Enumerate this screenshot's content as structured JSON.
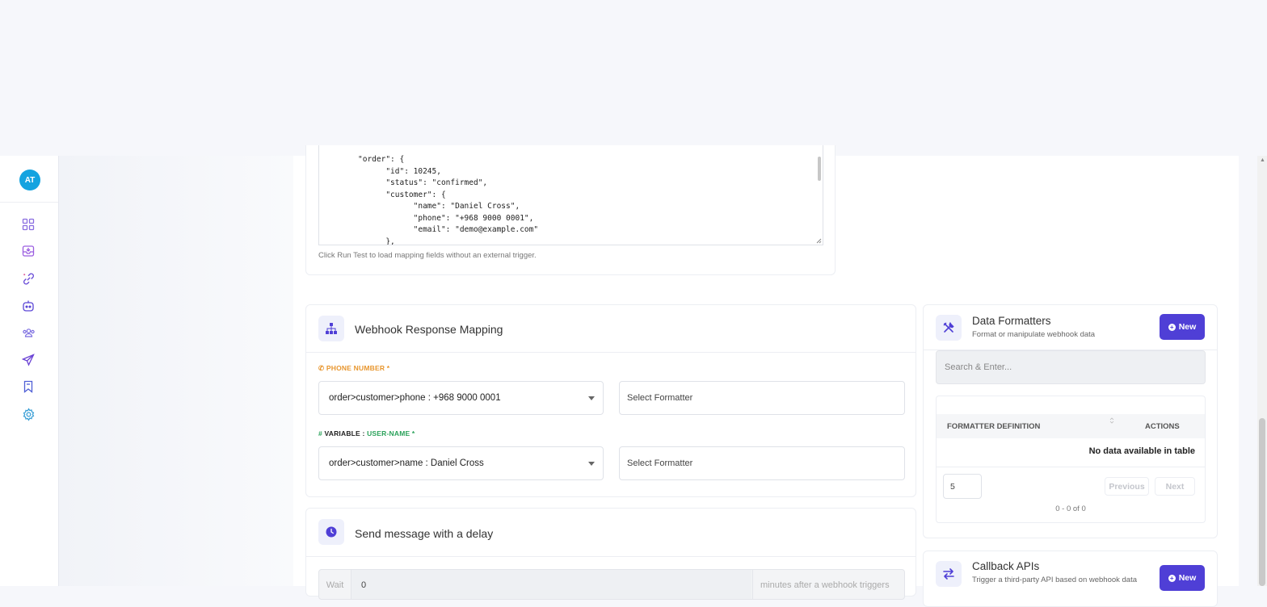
{
  "sidebar": {
    "avatar_initials": "AT",
    "items": [
      {
        "icon": "dashboard-grid-icon"
      },
      {
        "icon": "inbox-download-icon"
      },
      {
        "icon": "integration-link-icon"
      },
      {
        "icon": "bot-icon"
      },
      {
        "icon": "contacts-group-icon"
      },
      {
        "icon": "send-campaign-icon"
      },
      {
        "icon": "bookmark-icon"
      },
      {
        "icon": "settings-gear-icon"
      }
    ]
  },
  "json_test": {
    "content": "\"order\": {\n\t\"id\": 10245,\n\t\"status\": \"confirmed\",\n\t\"customer\": {\n\t\t\"name\": \"Daniel Cross\",\n\t\t\"phone\": \"+968 9000 0001\",\n\t\t\"email\": \"demo@example.com\"\n\t},",
    "hint": "Click Run Test to load mapping fields without an external trigger."
  },
  "mapping": {
    "title": "Webhook Response Mapping",
    "phone_label": "PHONE NUMBER *",
    "phone_value": "order>customer>phone : +968 9000 0001",
    "variable_prefix": "VARIABLE : ",
    "variable_name": "USER-NAME *",
    "variable_value": "order>customer>name : Daniel Cross",
    "formatter_placeholder": "Select Formatter"
  },
  "delay": {
    "title": "Send message with a delay",
    "wait_label": "Wait",
    "wait_value": "0",
    "wait_suffix": "minutes after a webhook triggers"
  },
  "formatters": {
    "title": "Data Formatters",
    "subtitle": "Format or manipulate webhook data",
    "new_label": "New",
    "search_placeholder": "Search & Enter...",
    "col_definition": "FORMATTER DEFINITION",
    "col_actions": "ACTIONS",
    "empty_text": "No data available in table",
    "page_size": "5",
    "prev_label": "Previous",
    "next_label": "Next",
    "page_info": "0 - 0 of 0"
  },
  "callbacks": {
    "title": "Callback APIs",
    "subtitle": "Trigger a third-party API based on webhook data",
    "new_label": "New"
  },
  "colors": {
    "accent": "#4f3fd6",
    "phone_label": "#e8962e",
    "variable_label": "#2aa25a",
    "avatar": "#14a3e0"
  }
}
